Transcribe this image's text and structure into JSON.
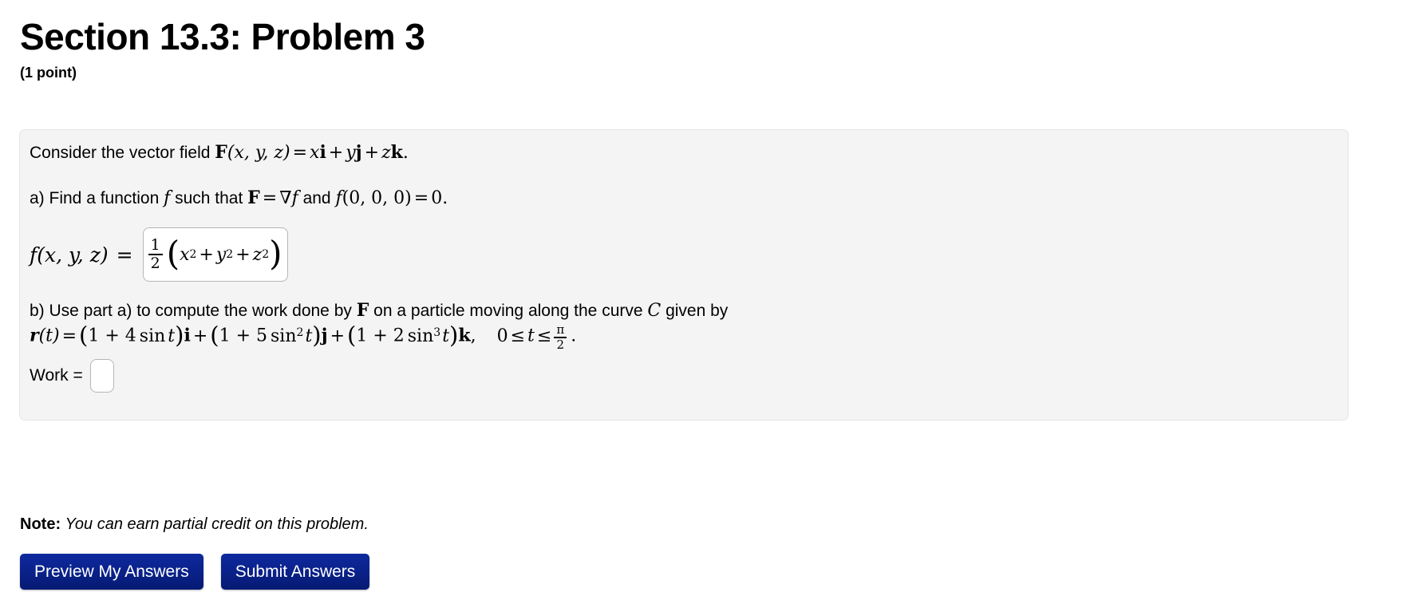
{
  "header": {
    "title": "Section 13.3: Problem 3",
    "points": "(1 point)"
  },
  "problem": {
    "intro": {
      "prefix": "Consider the vector field ",
      "F": "F",
      "args": "(x, y, z)",
      "equals": "=",
      "term1_var": "x",
      "term1_vec": "i",
      "plus1": "+",
      "term2_var": "y",
      "term2_vec": "j",
      "plus2": "+",
      "term3_var": "z",
      "term3_vec": "k",
      "period": "."
    },
    "part_a": {
      "label": "a) Find a function ",
      "f": "f",
      "mid": " such that ",
      "F": "F",
      "equals": "=",
      "grad": "∇",
      "grad_f": "f",
      "and": " and ",
      "f2": "f",
      "origin": "(0, 0, 0)",
      "eq2": "=",
      "zero": "0",
      "period": "."
    },
    "answer_a": {
      "lhs": "f(x, y, z)",
      "equals": "=",
      "value_numerator": "1",
      "value_denominator": "2",
      "open_paren": "(",
      "x": "x",
      "x_exp": "2",
      "plus1": "+",
      "y": "y",
      "y_exp": "2",
      "plus2": "+",
      "z": "z",
      "z_exp": "2",
      "close_paren": ")"
    },
    "part_b": {
      "label": "b) Use part a) to compute the work done by ",
      "F": "F",
      "mid": " on a particle moving along the curve ",
      "C": "C",
      "suffix": " given by"
    },
    "curve": {
      "r": "r",
      "t_arg": "(t)",
      "equals": "=",
      "open1": "(",
      "one_a": "1 + 4",
      "sin_a": "sin",
      "t_a": "t",
      "close1": ")",
      "vec_i": "i",
      "plus1": "+",
      "open2": "(",
      "one_b": "1 + 5",
      "sin_b": "sin",
      "sin_b_exp": "2",
      "t_b": "t",
      "close2": ")",
      "vec_j": "j",
      "plus2": "+",
      "open3": "(",
      "one_c": "1 + 2",
      "sin_c": "sin",
      "sin_c_exp": "3",
      "t_c": "t",
      "close3": ")",
      "vec_k": "k",
      "comma": ",",
      "range_lo": "0",
      "le1": "≤",
      "range_var": "t",
      "le2": "≤",
      "range_hi_num": "π",
      "range_hi_den": "2",
      "period": "."
    },
    "work": {
      "label": "Work =",
      "value": "",
      "placeholder": ""
    }
  },
  "footer": {
    "note_label": "Note:",
    "note_text": "You can earn partial credit on this problem.",
    "preview_button": "Preview My Answers",
    "submit_button": "Submit Answers"
  }
}
